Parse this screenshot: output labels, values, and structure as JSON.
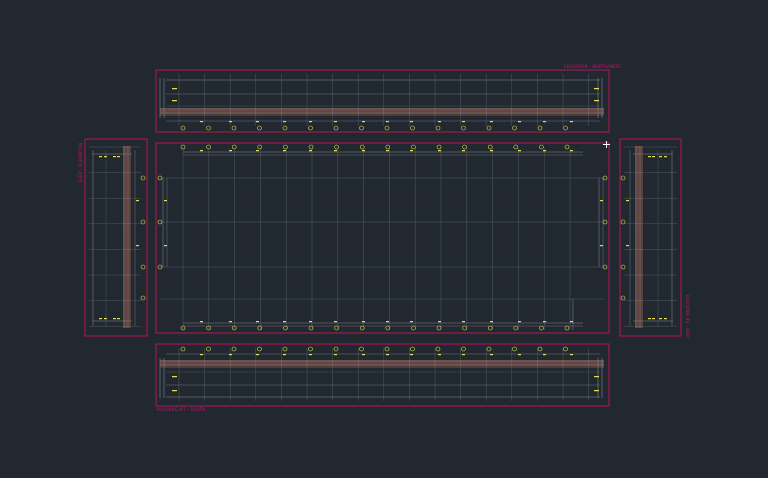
{
  "app": "CAD drawing viewport",
  "colors": {
    "background": "#212830",
    "frame": "#c8145a",
    "grid": "#55606a",
    "gridLight": "#7c8690",
    "annotation": "#e8e04a",
    "member": "#d8a07a",
    "memberAlt": "#e07070",
    "text": "#d01070"
  },
  "views": {
    "north": {
      "label": "ELEVATION - NORTH/WEST"
    },
    "west": {
      "label": "ELEV - ELEVATION"
    },
    "east": {
      "label": "BUILDING #1 - EAST"
    },
    "south": {
      "label": "BUILDING #1 - SOUTH"
    }
  }
}
